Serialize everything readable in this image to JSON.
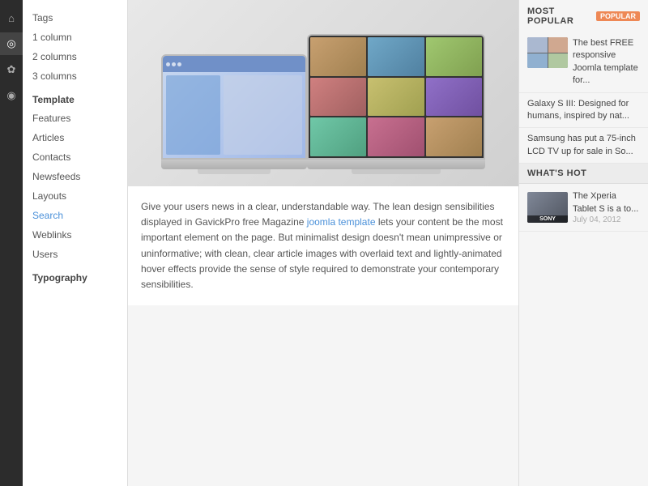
{
  "icon_sidebar": {
    "icons": [
      {
        "name": "home-icon",
        "symbol": "⌂",
        "active": false
      },
      {
        "name": "user-icon",
        "symbol": "◎",
        "active": true
      },
      {
        "name": "settings-icon",
        "symbol": "✿",
        "active": false
      },
      {
        "name": "bell-icon",
        "symbol": "◉",
        "active": false
      }
    ]
  },
  "nav_sidebar": {
    "group1": {
      "items": [
        {
          "label": "Tags",
          "href": "#"
        },
        {
          "label": "1 column",
          "href": "#"
        },
        {
          "label": "2 columns",
          "href": "#"
        },
        {
          "label": "3 columns",
          "href": "#"
        }
      ]
    },
    "template_section": {
      "title": "Template",
      "items": [
        {
          "label": "Features",
          "href": "#"
        },
        {
          "label": "Articles",
          "href": "#"
        },
        {
          "label": "Contacts",
          "href": "#"
        },
        {
          "label": "Newsfeeds",
          "href": "#"
        },
        {
          "label": "Layouts",
          "href": "#"
        },
        {
          "label": "Search",
          "href": "#",
          "active": true
        },
        {
          "label": "Weblinks",
          "href": "#"
        },
        {
          "label": "Users",
          "href": "#"
        }
      ]
    },
    "typography_section": {
      "title": "Typography"
    }
  },
  "hero": {
    "alt": "Two laptops showing responsive design"
  },
  "main_text": {
    "paragraph": "Give your users news in a clear, understandable way. The lean design sensibilities displayed in GavickPro free Magazine ",
    "link_text": "joomla template",
    "paragraph2": " lets your content be the most important element on the page. But minimalist design doesn't mean unimpressive or uninformative; with clean, clear article images with overlaid text and lightly-animated hover effects provide the sense of style required to demonstrate your contemporary sensibilities."
  },
  "right_sidebar": {
    "most_popular": {
      "title": "MOST POPULAR",
      "badge": "POPULAR",
      "articles": [
        {
          "title": "The best FREE responsive Joomla template for...",
          "has_thumb": true
        },
        {
          "title": "Galaxy S III: Designed for humans, inspired by nat...",
          "has_thumb": false
        },
        {
          "title": "Samsung has put a 75-inch LCD TV up for sale in So...",
          "has_thumb": false
        }
      ]
    },
    "whats_hot": {
      "title": "WHAT'S HOT",
      "articles": [
        {
          "title": "The Xperia Tablet S is a to...",
          "date": "July 04, 2012",
          "thumb_label": "SONY"
        }
      ]
    }
  }
}
